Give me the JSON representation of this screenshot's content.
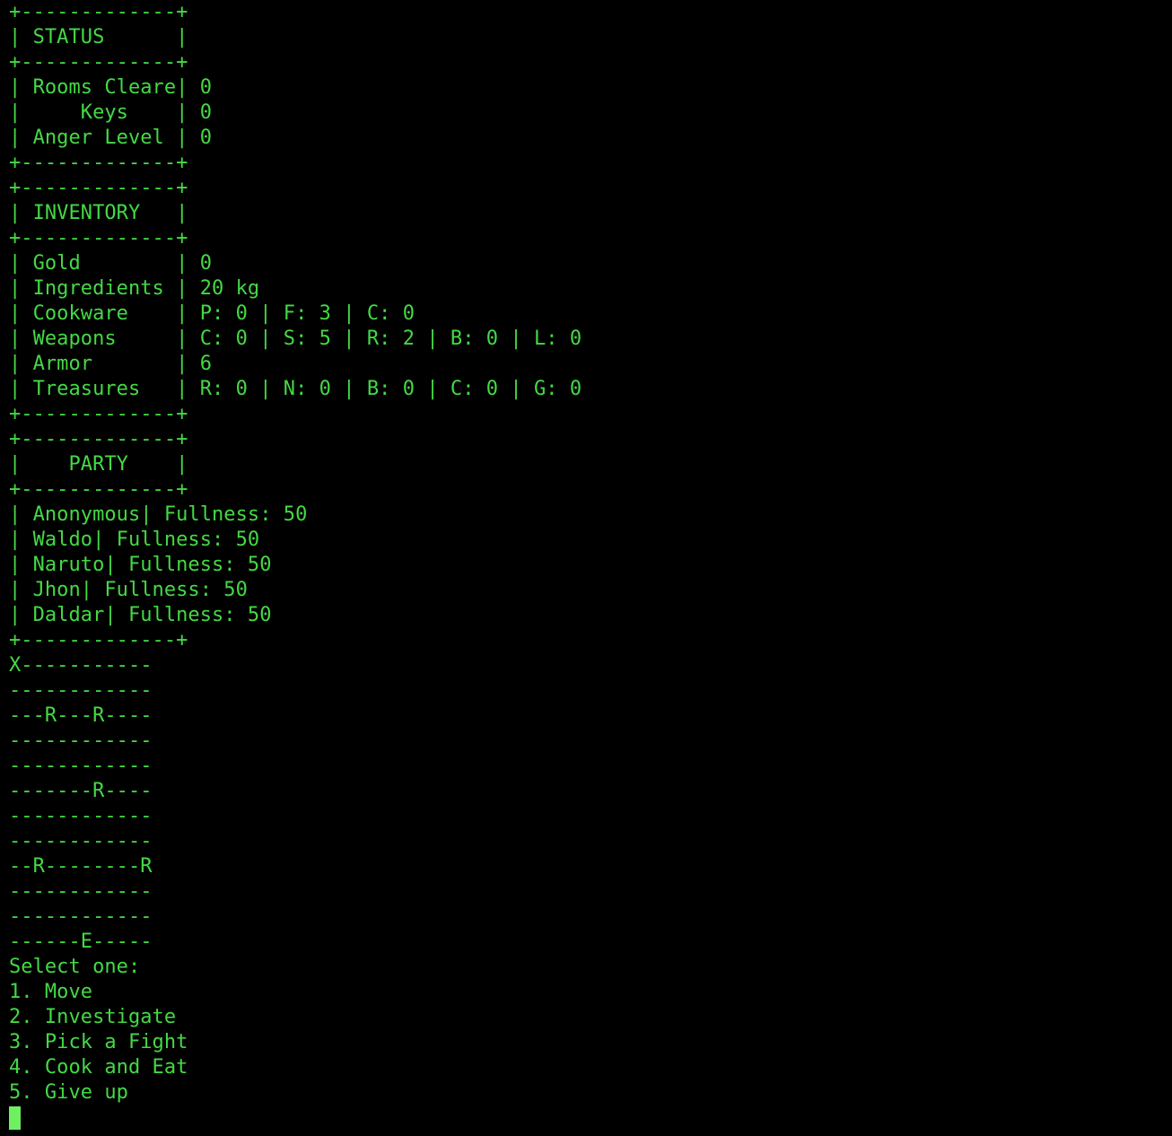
{
  "terminal": {
    "foreground_color": "#44d944",
    "background_color": "#000000",
    "cursor_color": "#6ef060",
    "box_width_chars": 15
  },
  "status_panel": {
    "title": "STATUS",
    "top_border": "+-------------+",
    "header_line": "| STATUS      |",
    "divider": "+-------------+",
    "bottom_border": "+-------------+",
    "rows": [
      {
        "line": "| Rooms Cleare| 0",
        "label": "Rooms Cleare",
        "value": "0"
      },
      {
        "line": "|     Keys    | 0",
        "label": "Keys",
        "value": "0"
      },
      {
        "line": "| Anger Level | 0",
        "label": "Anger Level",
        "value": "0"
      }
    ]
  },
  "inventory_panel": {
    "title": "INVENTORY",
    "top_border": "+-------------+",
    "header_line": "| INVENTORY   |",
    "divider": "+-------------+",
    "bottom_border": "+-------------+",
    "rows": [
      {
        "line": "| Gold        | 0",
        "label": "Gold",
        "value": "0"
      },
      {
        "line": "| Ingredients | 20 kg",
        "label": "Ingredients",
        "value": "20 kg"
      },
      {
        "line": "| Cookware    | P: 0 | F: 3 | C: 0",
        "label": "Cookware",
        "value": "P: 0 | F: 3 | C: 0"
      },
      {
        "line": "| Weapons     | C: 0 | S: 5 | R: 2 | B: 0 | L: 0",
        "label": "Weapons",
        "value": "C: 0 | S: 5 | R: 2 | B: 0 | L: 0"
      },
      {
        "line": "| Armor       | 6",
        "label": "Armor",
        "value": "6"
      },
      {
        "line": "| Treasures   | R: 0 | N: 0 | B: 0 | C: 0 | G: 0",
        "label": "Treasures",
        "value": "R: 0 | N: 0 | B: 0 | C: 0 | G: 0"
      }
    ]
  },
  "party_panel": {
    "title": "PARTY",
    "top_border": "+-------------+",
    "header_line": "|    PARTY    |",
    "divider": "+-------------+",
    "bottom_border": "+-------------+",
    "members": [
      {
        "line": "| Anonymous| Fullness: 50",
        "name": "Anonymous",
        "fullness": "50"
      },
      {
        "line": "| Waldo| Fullness: 50",
        "name": "Waldo",
        "fullness": "50"
      },
      {
        "line": "| Naruto| Fullness: 50",
        "name": "Naruto",
        "fullness": "50"
      },
      {
        "line": "| Jhon| Fullness: 50",
        "name": "Jhon",
        "fullness": "50"
      },
      {
        "line": "| Daldar| Fullness: 50",
        "name": "Daldar",
        "fullness": "50"
      }
    ]
  },
  "map": {
    "width_chars": 12,
    "legend": {
      "X": "player",
      "R": "room",
      "E": "exit",
      "-": "unexplored"
    },
    "rows": [
      "X-----------",
      "------------",
      "---R---R----",
      "------------",
      "------------",
      "-------R----",
      "------------",
      "------------",
      "--R--------R",
      "------------",
      "------------",
      "------E-----"
    ]
  },
  "prompt": {
    "title": "Select one:",
    "options": [
      "1. Move",
      "2. Investigate",
      "3. Pick a Fight",
      "4. Cook and Eat",
      "5. Give up"
    ],
    "input_value": ""
  }
}
